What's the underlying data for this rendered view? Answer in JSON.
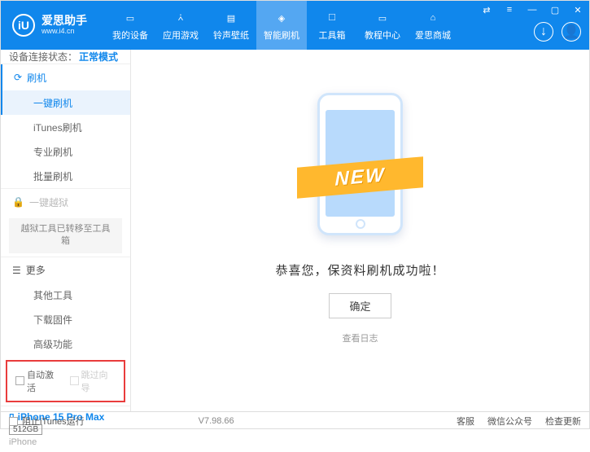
{
  "brand": {
    "title": "爱思助手",
    "url": "www.i4.cn",
    "logo_letter": "iU"
  },
  "nav": {
    "items": [
      {
        "label": "我的设备"
      },
      {
        "label": "应用游戏"
      },
      {
        "label": "铃声壁纸"
      },
      {
        "label": "智能刷机"
      },
      {
        "label": "工具箱"
      },
      {
        "label": "教程中心"
      },
      {
        "label": "爱思商城"
      }
    ]
  },
  "status": {
    "label": "设备连接状态：",
    "value": "正常模式"
  },
  "sidebar": {
    "flash": {
      "header": "刷机",
      "items": [
        "一键刷机",
        "iTunes刷机",
        "专业刷机",
        "批量刷机"
      ]
    },
    "jailbreak": {
      "header": "一键越狱",
      "note": "越狱工具已转移至工具箱"
    },
    "more": {
      "header": "更多",
      "items": [
        "其他工具",
        "下载固件",
        "高级功能"
      ]
    }
  },
  "checks": {
    "auto": "自动激活",
    "skip": "跳过向导"
  },
  "device": {
    "name": "iPhone 15 Pro Max",
    "capacity": "512GB",
    "type": "iPhone"
  },
  "main": {
    "ribbon": "NEW",
    "success": "恭喜您，保资料刷机成功啦！",
    "ok": "确定",
    "log": "查看日志"
  },
  "footer": {
    "block_itunes": "阻止iTunes运行",
    "version": "V7.98.66",
    "links": [
      "客服",
      "微信公众号",
      "检查更新"
    ]
  }
}
